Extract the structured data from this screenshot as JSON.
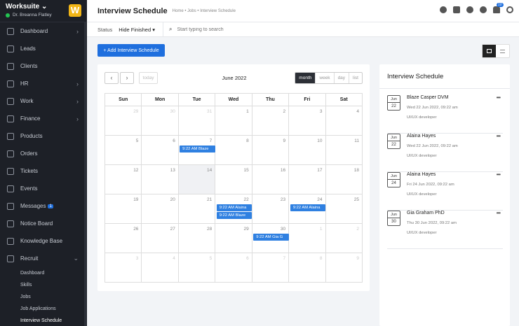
{
  "sidebar": {
    "app_name": "Worksuite",
    "user_name": "Dr. Breanna Flatley",
    "logo_letter": "W",
    "items": [
      {
        "label": "Dashboard",
        "icon": "home-icon",
        "has_chevron": true
      },
      {
        "label": "Leads",
        "icon": "user-icon",
        "has_chevron": false
      },
      {
        "label": "Clients",
        "icon": "building-icon",
        "has_chevron": false
      },
      {
        "label": "HR",
        "icon": "users-icon",
        "has_chevron": true
      },
      {
        "label": "Work",
        "icon": "briefcase-icon",
        "has_chevron": true
      },
      {
        "label": "Finance",
        "icon": "dollar-icon",
        "has_chevron": true
      },
      {
        "label": "Products",
        "icon": "box-icon",
        "has_chevron": false
      },
      {
        "label": "Orders",
        "icon": "cart-icon",
        "has_chevron": false
      },
      {
        "label": "Tickets",
        "icon": "headset-icon",
        "has_chevron": false
      },
      {
        "label": "Events",
        "icon": "calendar-icon",
        "has_chevron": false
      },
      {
        "label": "Messages",
        "icon": "chat-icon",
        "has_chevron": false,
        "badge": "1"
      },
      {
        "label": "Notice Board",
        "icon": "clipboard-icon",
        "has_chevron": false
      },
      {
        "label": "Knowledge Base",
        "icon": "book-icon",
        "has_chevron": false
      },
      {
        "label": "Recruit",
        "icon": "id-card-icon",
        "has_chevron": true,
        "expanded": true
      }
    ],
    "recruit_subitems": [
      "Dashboard",
      "Skills",
      "Jobs",
      "Job Applications",
      "Interview Schedule"
    ],
    "active_subitem": "Interview Schedule"
  },
  "header": {
    "title": "Interview Schedule",
    "breadcrumb": "Home • Jobs • Interview Schedule",
    "notification_count": "10",
    "icons": [
      "search-icon",
      "notes-icon",
      "clock-icon",
      "plus-circle-icon",
      "bell-icon",
      "power-icon"
    ]
  },
  "filter": {
    "status_label": "Status",
    "status_value": "Hide Finished",
    "search_placeholder": "Start typing to search"
  },
  "toolbar": {
    "add_label": "+ Add Interview Schedule"
  },
  "calendar": {
    "title": "June 2022",
    "today_label": "today",
    "views": [
      "month",
      "week",
      "day",
      "list"
    ],
    "active_view": "month",
    "weekdays": [
      "Sun",
      "Mon",
      "Tue",
      "Wed",
      "Thu",
      "Fri",
      "Sat"
    ],
    "weeks": [
      [
        {
          "d": "29",
          "o": true
        },
        {
          "d": "30",
          "o": true
        },
        {
          "d": "31",
          "o": true
        },
        {
          "d": "1"
        },
        {
          "d": "2"
        },
        {
          "d": "3"
        },
        {
          "d": "4"
        }
      ],
      [
        {
          "d": "5"
        },
        {
          "d": "6"
        },
        {
          "d": "7"
        },
        {
          "d": "8"
        },
        {
          "d": "9"
        },
        {
          "d": "10"
        },
        {
          "d": "11"
        }
      ],
      [
        {
          "d": "12"
        },
        {
          "d": "13"
        },
        {
          "d": "14",
          "today": true
        },
        {
          "d": "15"
        },
        {
          "d": "16"
        },
        {
          "d": "17"
        },
        {
          "d": "18"
        }
      ],
      [
        {
          "d": "19"
        },
        {
          "d": "20"
        },
        {
          "d": "21"
        },
        {
          "d": "22"
        },
        {
          "d": "23"
        },
        {
          "d": "24"
        },
        {
          "d": "25"
        }
      ],
      [
        {
          "d": "26"
        },
        {
          "d": "27"
        },
        {
          "d": "28"
        },
        {
          "d": "29"
        },
        {
          "d": "30"
        },
        {
          "d": "1",
          "o": true
        },
        {
          "d": "2",
          "o": true
        }
      ],
      [
        {
          "d": "3",
          "o": true
        },
        {
          "d": "4",
          "o": true
        },
        {
          "d": "5",
          "o": true
        },
        {
          "d": "6",
          "o": true
        },
        {
          "d": "7",
          "o": true
        },
        {
          "d": "8",
          "o": true
        },
        {
          "d": "9",
          "o": true
        }
      ]
    ],
    "events": [
      {
        "week": 1,
        "day": 2,
        "slot": 0,
        "label": "9:22 AM Blaze"
      },
      {
        "week": 3,
        "day": 3,
        "slot": 0,
        "label": "9:22 AM Alaina"
      },
      {
        "week": 3,
        "day": 3,
        "slot": 1,
        "label": "9:22 AM Blaze"
      },
      {
        "week": 3,
        "day": 5,
        "slot": 0,
        "label": "9:22 AM Alaina"
      },
      {
        "week": 4,
        "day": 4,
        "slot": 0,
        "label": "9:22 AM Gia G"
      }
    ],
    "event_color": "#2f80e1"
  },
  "schedule_panel": {
    "title": "Interview Schedule",
    "items": [
      {
        "month": "Jun",
        "day": "22",
        "name": "Blaze Casper DVM",
        "datetime": "Wed 22 Jun 2022, 09:22 am",
        "job": "UI/UX developer"
      },
      {
        "month": "Jun",
        "day": "22",
        "name": "Alaina Hayes",
        "datetime": "Wed 22 Jun 2022, 09:22 am",
        "job": "UI/UX developer"
      },
      {
        "month": "Jun",
        "day": "24",
        "name": "Alaina Hayes",
        "datetime": "Fri 24 Jun 2022, 09:22 am",
        "job": "UI/UX developer"
      },
      {
        "month": "Jun",
        "day": "30",
        "name": "Gia Graham PhD",
        "datetime": "Thu 30 Jun 2022, 09:22 am",
        "job": "UI/UX developer"
      }
    ]
  },
  "colors": {
    "accent": "#1f6fde",
    "sidebar_bg": "#1d2027",
    "logo": "#f2b617",
    "online": "#23c552"
  }
}
